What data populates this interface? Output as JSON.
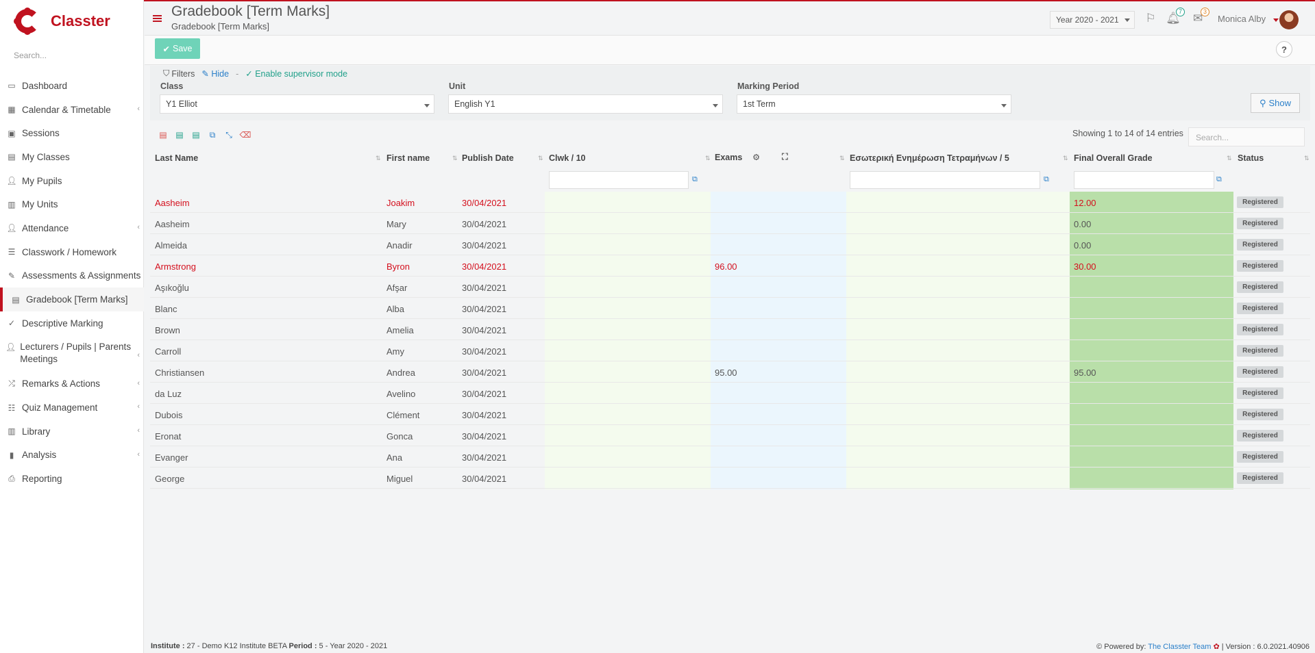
{
  "app": {
    "brand": "Classter",
    "search_placeholder": "Search..."
  },
  "sidebar": {
    "items": [
      {
        "label": "Dashboard",
        "icon": "laptop-icon",
        "caret": false
      },
      {
        "label": "Calendar & Timetable",
        "icon": "calendar-icon",
        "caret": true
      },
      {
        "label": "Sessions",
        "icon": "sessions-icon",
        "caret": false
      },
      {
        "label": "My Classes",
        "icon": "classes-icon",
        "caret": false
      },
      {
        "label": "My Pupils",
        "icon": "users-icon",
        "caret": false
      },
      {
        "label": "My Units",
        "icon": "book-icon",
        "caret": false
      },
      {
        "label": "Attendance",
        "icon": "attendance-icon",
        "caret": true
      },
      {
        "label": "Classwork / Homework",
        "icon": "tasks-icon",
        "caret": false
      },
      {
        "label": "Assessments & Assignments",
        "icon": "edit-icon",
        "caret": true
      },
      {
        "label": "Gradebook [Term Marks]",
        "icon": "gradebook-icon",
        "caret": false,
        "active": true
      },
      {
        "label": "Descriptive Marking",
        "icon": "marking-icon",
        "caret": false
      },
      {
        "label": "Lecturers / Pupils | Parents Meetings",
        "icon": "meeting-icon",
        "caret": true
      },
      {
        "label": "Remarks & Actions",
        "icon": "shuffle-icon",
        "caret": true
      },
      {
        "label": "Quiz Management",
        "icon": "quiz-icon",
        "caret": true
      },
      {
        "label": "Library",
        "icon": "library-icon",
        "caret": true
      },
      {
        "label": "Analysis",
        "icon": "chart-icon",
        "caret": true
      },
      {
        "label": "Reporting",
        "icon": "print-icon",
        "caret": false
      }
    ]
  },
  "header": {
    "title": "Gradebook [Term Marks]",
    "subtitle": "Gradebook [Term Marks]",
    "year": "Year 2020 - 2021",
    "notifications_count": "7",
    "messages_count": "3",
    "user_name": "Monica Alby"
  },
  "toolbar": {
    "save_label": "Save",
    "help_label": "?"
  },
  "filters": {
    "label": "Filters",
    "hide_label": "Hide",
    "separator": "-",
    "supervisor_label": "Enable supervisor mode",
    "class_label": "Class",
    "class_value": "Y1 Elliot",
    "unit_label": "Unit",
    "unit_value": "English Y1",
    "period_label": "Marking Period",
    "period_value": "1st Term",
    "show_label": "Show"
  },
  "table": {
    "entries_text": "Showing 1 to 14 of 14 entries",
    "search_placeholder": "Search...",
    "columns": {
      "last_name": "Last Name",
      "first_name": "First name",
      "publish_date": "Publish Date",
      "clwk": "Clwk / 10",
      "exams": "Exams",
      "internal": "Εσωτερική Ενημέρωση Τετραμήνων / 5",
      "final": "Final Overall Grade",
      "status": "Status"
    },
    "rows": [
      {
        "last": "Aasheim",
        "first": "Joakim",
        "date": "30/04/2021",
        "exam": "",
        "final": "12.00",
        "status": "Registered",
        "highlight": true
      },
      {
        "last": "Aasheim",
        "first": "Mary",
        "date": "30/04/2021",
        "exam": "",
        "final": "0.00",
        "status": "Registered",
        "highlight": false
      },
      {
        "last": "Almeida",
        "first": "Anadir",
        "date": "30/04/2021",
        "exam": "",
        "final": "0.00",
        "status": "Registered",
        "highlight": false
      },
      {
        "last": "Armstrong",
        "first": "Byron",
        "date": "30/04/2021",
        "exam": "96.00",
        "final": "30.00",
        "status": "Registered",
        "highlight": true
      },
      {
        "last": "Aşıkoğlu",
        "first": "Afşar",
        "date": "30/04/2021",
        "exam": "",
        "final": "",
        "status": "Registered",
        "highlight": false
      },
      {
        "last": "Blanc",
        "first": "Alba",
        "date": "30/04/2021",
        "exam": "",
        "final": "",
        "status": "Registered",
        "highlight": false
      },
      {
        "last": "Brown",
        "first": "Amelia",
        "date": "30/04/2021",
        "exam": "",
        "final": "",
        "status": "Registered",
        "highlight": false
      },
      {
        "last": "Carroll",
        "first": "Amy",
        "date": "30/04/2021",
        "exam": "",
        "final": "",
        "status": "Registered",
        "highlight": false
      },
      {
        "last": "Christiansen",
        "first": "Andrea",
        "date": "30/04/2021",
        "exam": "95.00",
        "final": "95.00",
        "status": "Registered",
        "highlight": false
      },
      {
        "last": "da Luz",
        "first": "Avelino",
        "date": "30/04/2021",
        "exam": "",
        "final": "",
        "status": "Registered",
        "highlight": false
      },
      {
        "last": "Dubois",
        "first": "Clément",
        "date": "30/04/2021",
        "exam": "",
        "final": "",
        "status": "Registered",
        "highlight": false
      },
      {
        "last": "Eronat",
        "first": "Gonca",
        "date": "30/04/2021",
        "exam": "",
        "final": "",
        "status": "Registered",
        "highlight": false
      },
      {
        "last": "Evanger",
        "first": "Ana",
        "date": "30/04/2021",
        "exam": "",
        "final": "",
        "status": "Registered",
        "highlight": false
      },
      {
        "last": "George",
        "first": "Miguel",
        "date": "30/04/2021",
        "exam": "",
        "final": "",
        "status": "Registered",
        "highlight": false
      }
    ]
  },
  "footer": {
    "institute_label": "Institute :",
    "institute_value": " 27 - Demo K12 Institute BETA ",
    "period_label": "Period :",
    "period_value": " 5 - Year 2020 - 2021",
    "powered_by": "Powered by:",
    "team": "The Classter Team",
    "version": "| Version : 6.0.2021.40906"
  },
  "colors": {
    "brand": "#c0121f",
    "accent": "#6fd3b8",
    "link": "#2a7fc9",
    "highlight_text": "#d40f1d",
    "final_grade_bg": "#b9dfa9",
    "exams_bg": "#ebf6fd",
    "clwk_bg": "#f4fbee"
  }
}
